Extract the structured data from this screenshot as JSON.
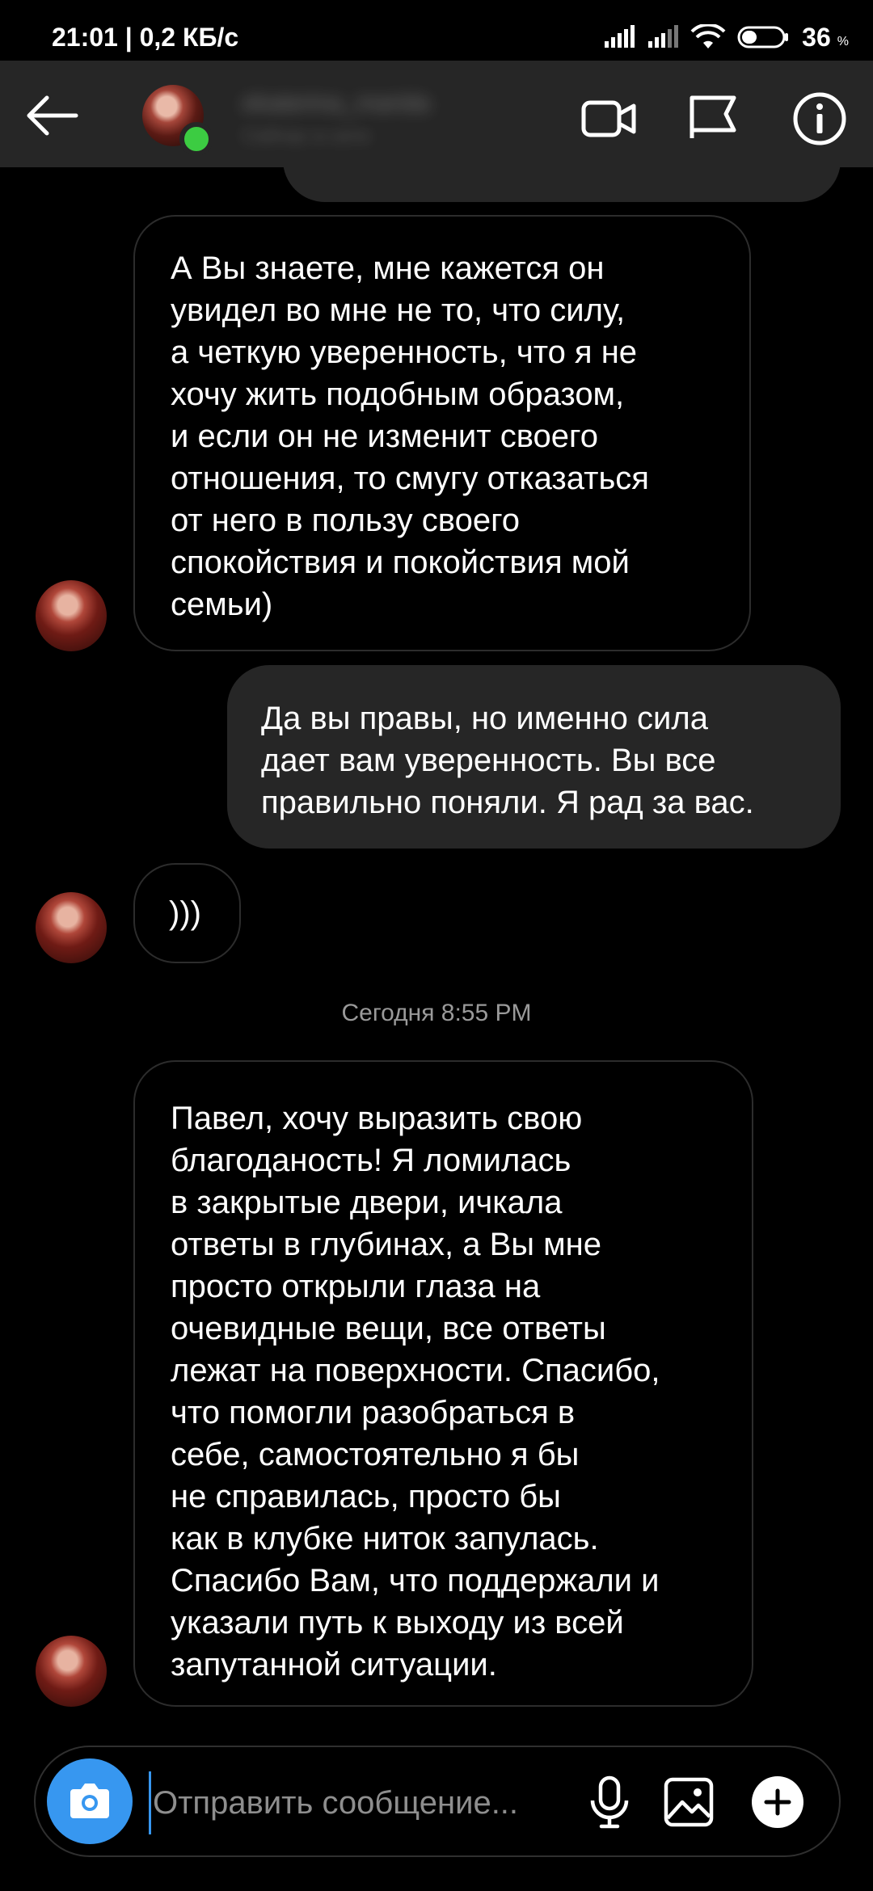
{
  "status_bar": {
    "time": "21:01 | 0,2 КБ/с",
    "battery": "36",
    "battery_pct": "%"
  },
  "header": {
    "name": "ekaterina_marida",
    "subtitle": "Сейчас в сети"
  },
  "messages": [
    {
      "side": "in",
      "text": "А Вы знаете, мне кажется он\nувидел во мне не то, что силу,\nа четкую уверенность, что я не\nхочу жить подобным образом,\nи если он не изменит своего\nотношения, то смугу отказаться\nот него в пользу своего\nспокойствия и покойствия мой\nсемьи)"
    },
    {
      "side": "out",
      "text": "Да вы правы, но именно сила\nдает вам уверенность. Вы все\nправильно поняли. Я рад за вас."
    },
    {
      "side": "in",
      "text": ")))"
    },
    {
      "side": "in",
      "text": "Павел, хочу выразить свою\nблагоданость! Я ломилась\nв закрытые двери, ичкала\nответы в глубинах, а Вы мне\nпросто открыли глаза на\nочевидные вещи, все ответы\nлежат на поверхности. Спасибо,\nчто помогли разобраться в\nсебе, самостоятельно я бы\nне справилась, просто бы\nкак в клубке ниток запулась.\nСпасибо Вам, что поддержали и\nуказали путь к выходу из всей\nзапутанной ситуации."
    }
  ],
  "timestamp": "Сегодня 8:55 PM",
  "composer": {
    "placeholder": "Отправить сообщение..."
  },
  "icons": {
    "back": "back-arrow-icon",
    "video": "video-camera-icon",
    "flag": "flag-icon",
    "info": "info-icon",
    "camera": "camera-icon",
    "mic": "microphone-icon",
    "gallery": "gallery-icon",
    "add": "plus-circle-icon"
  },
  "colors": {
    "accent": "#3797f0",
    "online": "#3ccc42",
    "header_bg": "#262626",
    "outgoing_bubble": "#262626",
    "background": "#000000"
  }
}
